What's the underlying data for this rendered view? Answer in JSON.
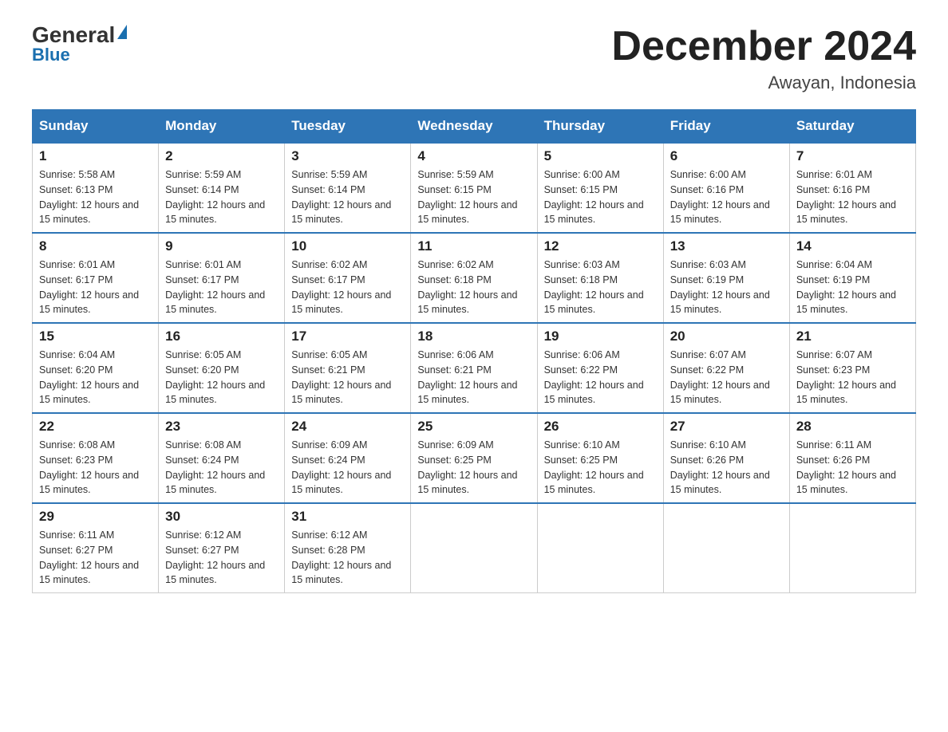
{
  "header": {
    "logo_general": "General",
    "logo_blue": "Blue",
    "month_title": "December 2024",
    "location": "Awayan, Indonesia"
  },
  "days_of_week": [
    "Sunday",
    "Monday",
    "Tuesday",
    "Wednesday",
    "Thursday",
    "Friday",
    "Saturday"
  ],
  "weeks": [
    [
      {
        "day": "1",
        "sunrise": "5:58 AM",
        "sunset": "6:13 PM",
        "daylight": "12 hours and 15 minutes."
      },
      {
        "day": "2",
        "sunrise": "5:59 AM",
        "sunset": "6:14 PM",
        "daylight": "12 hours and 15 minutes."
      },
      {
        "day": "3",
        "sunrise": "5:59 AM",
        "sunset": "6:14 PM",
        "daylight": "12 hours and 15 minutes."
      },
      {
        "day": "4",
        "sunrise": "5:59 AM",
        "sunset": "6:15 PM",
        "daylight": "12 hours and 15 minutes."
      },
      {
        "day": "5",
        "sunrise": "6:00 AM",
        "sunset": "6:15 PM",
        "daylight": "12 hours and 15 minutes."
      },
      {
        "day": "6",
        "sunrise": "6:00 AM",
        "sunset": "6:16 PM",
        "daylight": "12 hours and 15 minutes."
      },
      {
        "day": "7",
        "sunrise": "6:01 AM",
        "sunset": "6:16 PM",
        "daylight": "12 hours and 15 minutes."
      }
    ],
    [
      {
        "day": "8",
        "sunrise": "6:01 AM",
        "sunset": "6:17 PM",
        "daylight": "12 hours and 15 minutes."
      },
      {
        "day": "9",
        "sunrise": "6:01 AM",
        "sunset": "6:17 PM",
        "daylight": "12 hours and 15 minutes."
      },
      {
        "day": "10",
        "sunrise": "6:02 AM",
        "sunset": "6:17 PM",
        "daylight": "12 hours and 15 minutes."
      },
      {
        "day": "11",
        "sunrise": "6:02 AM",
        "sunset": "6:18 PM",
        "daylight": "12 hours and 15 minutes."
      },
      {
        "day": "12",
        "sunrise": "6:03 AM",
        "sunset": "6:18 PM",
        "daylight": "12 hours and 15 minutes."
      },
      {
        "day": "13",
        "sunrise": "6:03 AM",
        "sunset": "6:19 PM",
        "daylight": "12 hours and 15 minutes."
      },
      {
        "day": "14",
        "sunrise": "6:04 AM",
        "sunset": "6:19 PM",
        "daylight": "12 hours and 15 minutes."
      }
    ],
    [
      {
        "day": "15",
        "sunrise": "6:04 AM",
        "sunset": "6:20 PM",
        "daylight": "12 hours and 15 minutes."
      },
      {
        "day": "16",
        "sunrise": "6:05 AM",
        "sunset": "6:20 PM",
        "daylight": "12 hours and 15 minutes."
      },
      {
        "day": "17",
        "sunrise": "6:05 AM",
        "sunset": "6:21 PM",
        "daylight": "12 hours and 15 minutes."
      },
      {
        "day": "18",
        "sunrise": "6:06 AM",
        "sunset": "6:21 PM",
        "daylight": "12 hours and 15 minutes."
      },
      {
        "day": "19",
        "sunrise": "6:06 AM",
        "sunset": "6:22 PM",
        "daylight": "12 hours and 15 minutes."
      },
      {
        "day": "20",
        "sunrise": "6:07 AM",
        "sunset": "6:22 PM",
        "daylight": "12 hours and 15 minutes."
      },
      {
        "day": "21",
        "sunrise": "6:07 AM",
        "sunset": "6:23 PM",
        "daylight": "12 hours and 15 minutes."
      }
    ],
    [
      {
        "day": "22",
        "sunrise": "6:08 AM",
        "sunset": "6:23 PM",
        "daylight": "12 hours and 15 minutes."
      },
      {
        "day": "23",
        "sunrise": "6:08 AM",
        "sunset": "6:24 PM",
        "daylight": "12 hours and 15 minutes."
      },
      {
        "day": "24",
        "sunrise": "6:09 AM",
        "sunset": "6:24 PM",
        "daylight": "12 hours and 15 minutes."
      },
      {
        "day": "25",
        "sunrise": "6:09 AM",
        "sunset": "6:25 PM",
        "daylight": "12 hours and 15 minutes."
      },
      {
        "day": "26",
        "sunrise": "6:10 AM",
        "sunset": "6:25 PM",
        "daylight": "12 hours and 15 minutes."
      },
      {
        "day": "27",
        "sunrise": "6:10 AM",
        "sunset": "6:26 PM",
        "daylight": "12 hours and 15 minutes."
      },
      {
        "day": "28",
        "sunrise": "6:11 AM",
        "sunset": "6:26 PM",
        "daylight": "12 hours and 15 minutes."
      }
    ],
    [
      {
        "day": "29",
        "sunrise": "6:11 AM",
        "sunset": "6:27 PM",
        "daylight": "12 hours and 15 minutes."
      },
      {
        "day": "30",
        "sunrise": "6:12 AM",
        "sunset": "6:27 PM",
        "daylight": "12 hours and 15 minutes."
      },
      {
        "day": "31",
        "sunrise": "6:12 AM",
        "sunset": "6:28 PM",
        "daylight": "12 hours and 15 minutes."
      },
      null,
      null,
      null,
      null
    ]
  ]
}
